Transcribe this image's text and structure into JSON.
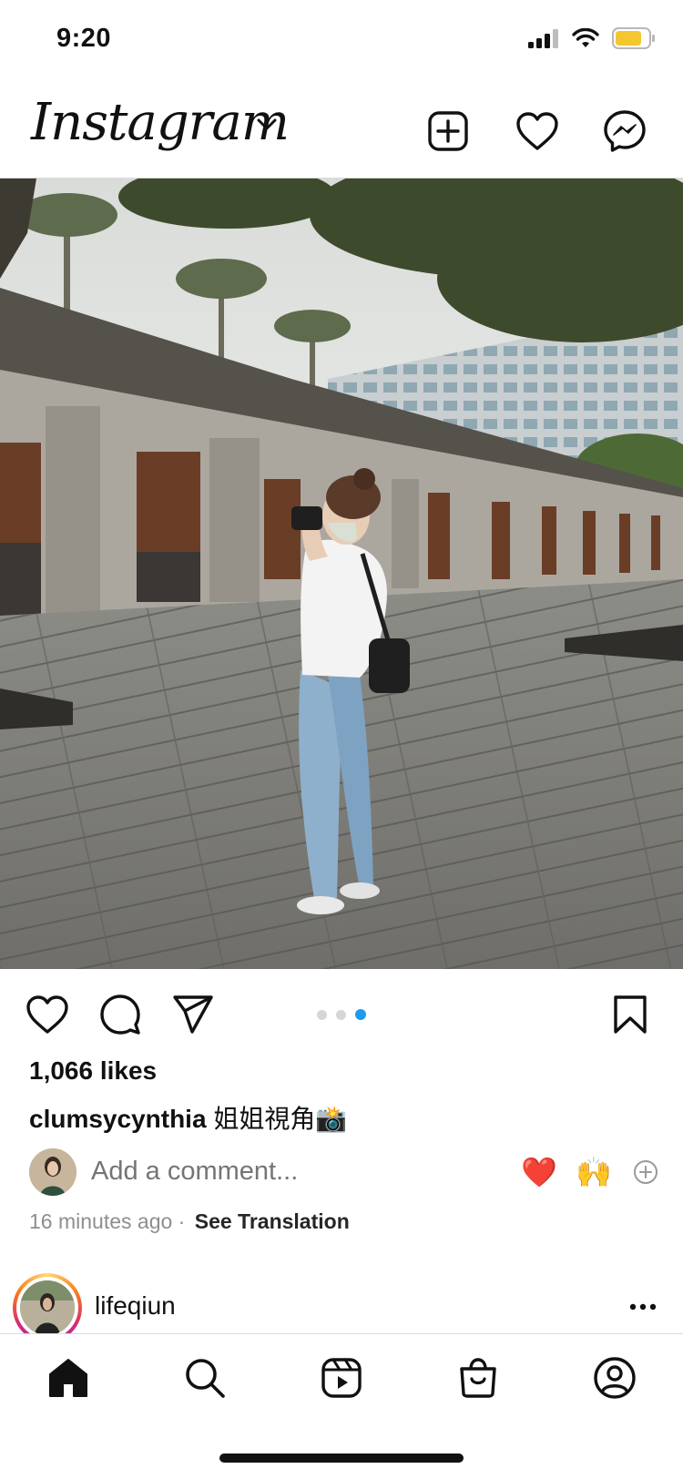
{
  "status_bar": {
    "time": "9:20",
    "icons": [
      "cellular-signal-icon",
      "wifi-icon",
      "battery-icon"
    ],
    "battery_color": "#f4c62f"
  },
  "header": {
    "logo": "Instagram",
    "icons": [
      "chevron-down-icon",
      "new-post-icon",
      "heart-icon",
      "messenger-icon"
    ]
  },
  "post": {
    "photo_alt": "Woman taking a photo on a wooden boardwalk in front of a historic building",
    "carousel": {
      "total": 3,
      "active_index": 2,
      "active_color": "#1d9bf0"
    },
    "likes": "1,066 likes",
    "caption_user": "clumsycynthia",
    "caption_text": "姐姐視角📸",
    "comment_placeholder": "Add a comment...",
    "quick_reactions": [
      "❤️",
      "🙌"
    ],
    "time_ago": "16 minutes ago",
    "separator": "·",
    "see_translation": "See Translation"
  },
  "next_post": {
    "username": "lifeqiun"
  },
  "tab_bar": {
    "tabs": [
      "home-icon",
      "search-icon",
      "reels-icon",
      "shop-icon",
      "profile-icon"
    ],
    "active": "home-icon"
  }
}
